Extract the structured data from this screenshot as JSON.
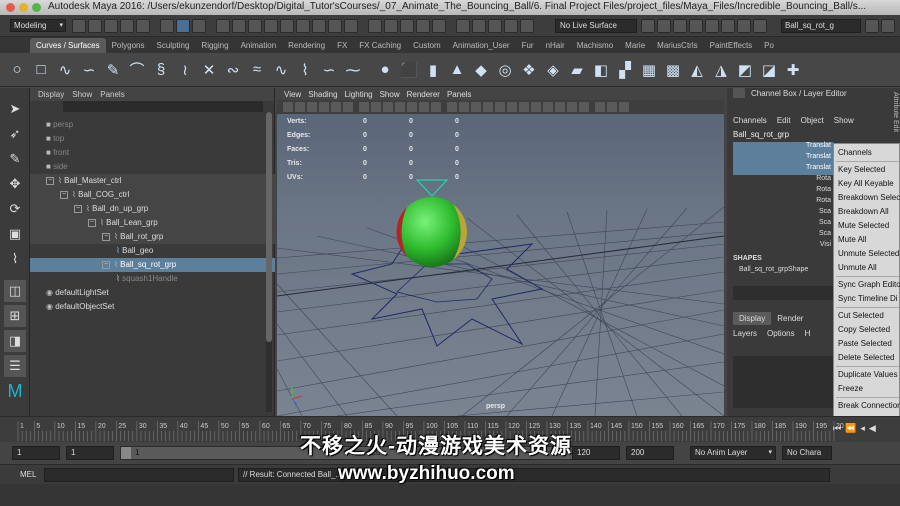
{
  "title_bar": {
    "title": "Autodesk Maya 2016: /Users/ekunzendorf/Desktop/Digital_Tutor'sCourses/_07_Animate_The_Bouncing_Ball/6. Final Project Files/project_files/Maya_Files/Incredible_Bouncing_Ball/s..."
  },
  "status_line": {
    "menu_set": "Modeling",
    "live_surface": "No Live Surface",
    "object_field": "Ball_sq_rot_g"
  },
  "shelf_tabs": [
    {
      "label": "Curves / Surfaces",
      "active": true
    },
    {
      "label": "Polygons"
    },
    {
      "label": "Sculpting"
    },
    {
      "label": "Rigging"
    },
    {
      "label": "Animation"
    },
    {
      "label": "Rendering"
    },
    {
      "label": "FX"
    },
    {
      "label": "FX Caching"
    },
    {
      "label": "Custom"
    },
    {
      "label": "Animation_User"
    },
    {
      "label": "Fur"
    },
    {
      "label": "nHair"
    },
    {
      "label": "Machismo"
    },
    {
      "label": "Marie"
    },
    {
      "label": "MariusCtrls"
    },
    {
      "label": "PaintEffects"
    },
    {
      "label": "Po"
    }
  ],
  "outliner": {
    "menu": [
      "Display",
      "Show",
      "Panels"
    ],
    "items": [
      {
        "label": "persp",
        "depth": 0,
        "style": "dim"
      },
      {
        "label": "top",
        "depth": 0,
        "style": "dim"
      },
      {
        "label": "front",
        "depth": 0,
        "style": "dim"
      },
      {
        "label": "side",
        "depth": 0,
        "style": "dim"
      },
      {
        "label": "Ball_Master_ctrl",
        "depth": 0,
        "style": "grp"
      },
      {
        "label": "Ball_COG_ctrl",
        "depth": 1,
        "style": "grp"
      },
      {
        "label": "Ball_dn_up_grp",
        "depth": 2,
        "style": "grp"
      },
      {
        "label": "Ball_Lean_grp",
        "depth": 3,
        "style": "grp"
      },
      {
        "label": "Ball_rot_grp",
        "depth": 4,
        "style": "grp"
      },
      {
        "label": "Ball_geo",
        "depth": 5,
        "style": "normal"
      },
      {
        "label": "Ball_sq_rot_grp",
        "depth": 4,
        "style": "sel"
      },
      {
        "label": "squash1Handle",
        "depth": 5,
        "style": "dim"
      },
      {
        "label": "defaultLightSet",
        "depth": 0,
        "style": "normal"
      },
      {
        "label": "defaultObjectSet",
        "depth": 0,
        "style": "normal"
      }
    ]
  },
  "viewport": {
    "menu": [
      "View",
      "Shading",
      "Lighting",
      "Show",
      "Renderer",
      "Panels"
    ],
    "hud": [
      {
        "label": "Verts:",
        "values": [
          "0",
          "0",
          "0"
        ]
      },
      {
        "label": "Edges:",
        "values": [
          "0",
          "0",
          "0"
        ]
      },
      {
        "label": "Faces:",
        "values": [
          "0",
          "0",
          "0"
        ]
      },
      {
        "label": "Tris:",
        "values": [
          "0",
          "0",
          "0"
        ]
      },
      {
        "label": "UVs:",
        "values": [
          "0",
          "0",
          "0"
        ]
      }
    ],
    "camera_label": "persp"
  },
  "channel_box": {
    "header": "Channel Box / Layer Editor",
    "menu": [
      "Channels",
      "Edit",
      "Object",
      "Show"
    ],
    "node": "Ball_sq_rot_grp",
    "attrs": [
      {
        "label": "Translat",
        "selected": true
      },
      {
        "label": "Translat",
        "selected": true
      },
      {
        "label": "Translat",
        "selected": true
      },
      {
        "label": "Rota"
      },
      {
        "label": "Rota"
      },
      {
        "label": "Rota"
      },
      {
        "label": "Sca"
      },
      {
        "label": "Sca"
      },
      {
        "label": "Sca"
      },
      {
        "label": "Visi"
      }
    ],
    "shapes_header": "SHAPES",
    "shape_name": "Ball_sq_rot_grpShape",
    "layer_tabs": [
      "Display",
      "Render"
    ],
    "layer_menu": [
      "Layers",
      "Options",
      "H"
    ],
    "side_tab": "Attribute Edit"
  },
  "context_menu": {
    "items": [
      {
        "label": "Channels",
        "sep_after": true
      },
      {
        "label": "Key Selected"
      },
      {
        "label": "Key All Keyable"
      },
      {
        "label": "Breakdown Selec"
      },
      {
        "label": "Breakdown All"
      },
      {
        "label": "Mute Selected"
      },
      {
        "label": "Mute All"
      },
      {
        "label": "Unmute Selected"
      },
      {
        "label": "Unmute All",
        "sep_after": true
      },
      {
        "label": "Sync Graph Edito"
      },
      {
        "label": "Sync Timeline Di",
        "sep_after": true
      },
      {
        "label": "Cut Selected"
      },
      {
        "label": "Copy Selected"
      },
      {
        "label": "Paste Selected"
      },
      {
        "label": "Delete Selected",
        "sep_after": true
      },
      {
        "label": "Duplicate Values"
      },
      {
        "label": "Freeze",
        "sep_after": true
      },
      {
        "label": "Break Connection"
      },
      {
        "label": "Select Connectio",
        "sep_after": true
      },
      {
        "label": "Lock Selected"
      },
      {
        "label": "Unlock Selected"
      },
      {
        "label": "Hide Selected"
      },
      {
        "label": "Lock and Hide Se",
        "highlight": true
      },
      {
        "label": "Make Selected N"
      }
    ]
  },
  "time_slider": {
    "ticks": [
      "1",
      "5",
      "10",
      "15",
      "20",
      "25",
      "30",
      "35",
      "40",
      "45",
      "50",
      "55",
      "60",
      "65",
      "70",
      "75",
      "80",
      "85",
      "90",
      "95",
      "100",
      "105",
      "110",
      "115",
      "120",
      "125",
      "130",
      "135",
      "140",
      "145",
      "150",
      "155",
      "160",
      "165",
      "170",
      "175",
      "180",
      "185",
      "190",
      "195",
      "200"
    ]
  },
  "range_slider": {
    "start_min": "1",
    "start": "1",
    "range_start": "1",
    "range_end_label": "120",
    "end": "120",
    "end_max": "200",
    "anim_layer": "No Anim Layer",
    "char_set": "No Chara"
  },
  "command_line": {
    "lang": "MEL",
    "result": "// Result: Connected Ball_..."
  },
  "watermark": {
    "line1": "不移之火-动漫游戏美术资源",
    "line2": "www.byzhihuo.com"
  },
  "colors": {
    "selection": "#5c7f9c",
    "menu_highlight": "#3f78d0",
    "ball_green": "#33c233",
    "ball_red": "#cc2222",
    "ball_yellow": "#c9b33a"
  }
}
